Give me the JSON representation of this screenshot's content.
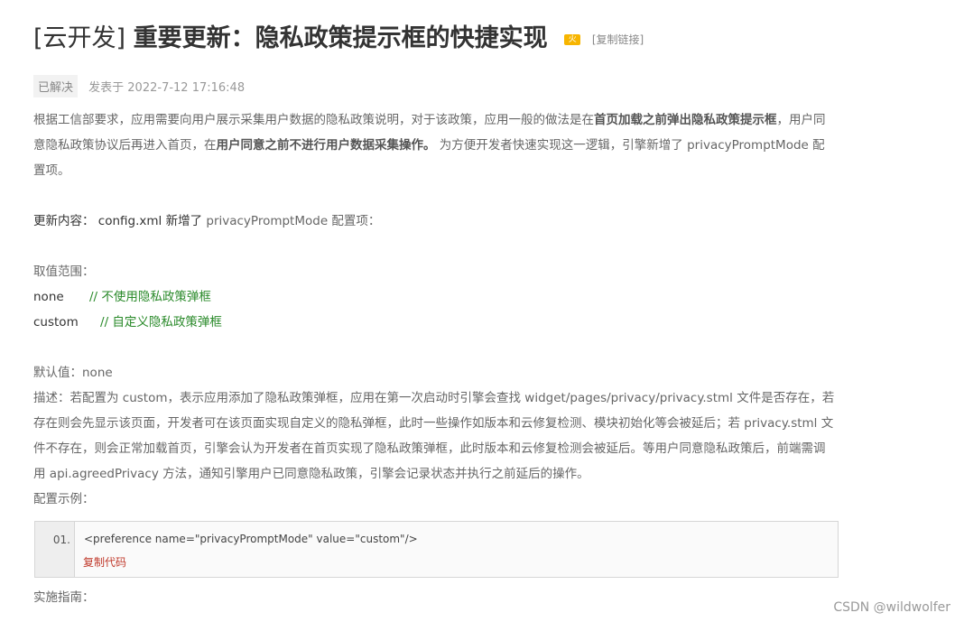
{
  "title": {
    "tag": "[云开发]",
    "main": "重要更新：隐私政策提示框的快捷实现",
    "copy_link": "[复制链接]"
  },
  "meta": {
    "status": "已解决",
    "posted": "发表于 2022-7-12 17:16:48"
  },
  "intro": {
    "t1": "根据工信部要求，应用需要向用户展示采集用户数据的隐私政策说明，对于该政策，应用一般的做法是在",
    "b1": "首页加载之前弹出隐私政策提示框",
    "t2": "，用户同意隐私政策协议后再进入首页，在",
    "b2": "用户同意之前不进行用户数据采集操作。",
    "t3": " 为方便开发者快速实现这一逻辑，引擎新增了 privacyPromptMode 配置项。"
  },
  "update": {
    "label": "更新内容：",
    "text": " config.xml 新增了 ",
    "key": "privacyPromptMode",
    "tail": "  配置项："
  },
  "range": {
    "label": "取值范围：",
    "options": [
      {
        "name": "none",
        "comment": "// 不使用隐私政策弹框"
      },
      {
        "name": "custom",
        "comment": "// 自定义隐私政策弹框"
      }
    ]
  },
  "default": "默认值：none",
  "description": "描述：若配置为 custom，表示应用添加了隐私政策弹框，应用在第一次启动时引擎会查找 widget/pages/privacy/privacy.stml 文件是否存在，若存在则会先显示该页面，开发者可在该页面实现自定义的隐私弹框，此时一些操作如版本和云修复检测、模块初始化等会被延后；若 privacy.stml 文件不存在，则会正常加载首页，引擎会认为开发者在首页实现了隐私政策弹框，此时版本和云修复检测会被延后。等用户同意隐私政策后，前端需调用 api.agreedPrivacy 方法，通知引擎用户已同意隐私政策，引擎会记录状态并执行之前延后的操作。",
  "example_label": "配置示例：",
  "code": {
    "line_no": "01.",
    "line": "<preference name=\"privacyPromptMode\" value=\"custom\"/>",
    "copy": "复制代码"
  },
  "guide_label": "实施指南：",
  "watermark": "CSDN @wildwolfer",
  "colors": {
    "comment": "#2a8a2a",
    "copy_code": "#c0392b",
    "badge_bg": "#f2f2f2"
  }
}
